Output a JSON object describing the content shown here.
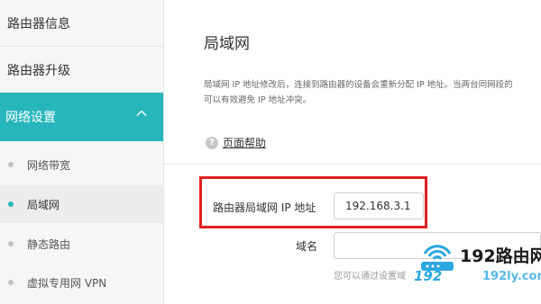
{
  "sidebar": {
    "top_items": [
      {
        "label": "路由器信息"
      },
      {
        "label": "路由器升级"
      }
    ],
    "section": {
      "label": "网络设置"
    },
    "sub_items": [
      {
        "label": "网络带宽"
      },
      {
        "label": "局域网"
      },
      {
        "label": "静态路由"
      },
      {
        "label": "虚拟专用网 VPN"
      }
    ]
  },
  "main": {
    "title": "局域网",
    "description_line1": "局域网 IP 地址修改后，连接到路由器的设备会重新分配 IP 地址。当两台同网段的",
    "description_line2": "可以有效避免 IP 地址冲突。",
    "help_link": "页面帮助",
    "lan_ip_label": "路由器局域网 IP 地址",
    "lan_ip_value": "192.168.3.1",
    "domain_label": "域名",
    "domain_value": "",
    "hint": "您可以通过设置域"
  },
  "watermark": {
    "brand": "192路由网",
    "domain": "192",
    "domain2": "192ly.com"
  },
  "colors": {
    "accent": "#28b6bd",
    "highlight": "#e02020",
    "watermark_blue": "#2aa7e0"
  }
}
